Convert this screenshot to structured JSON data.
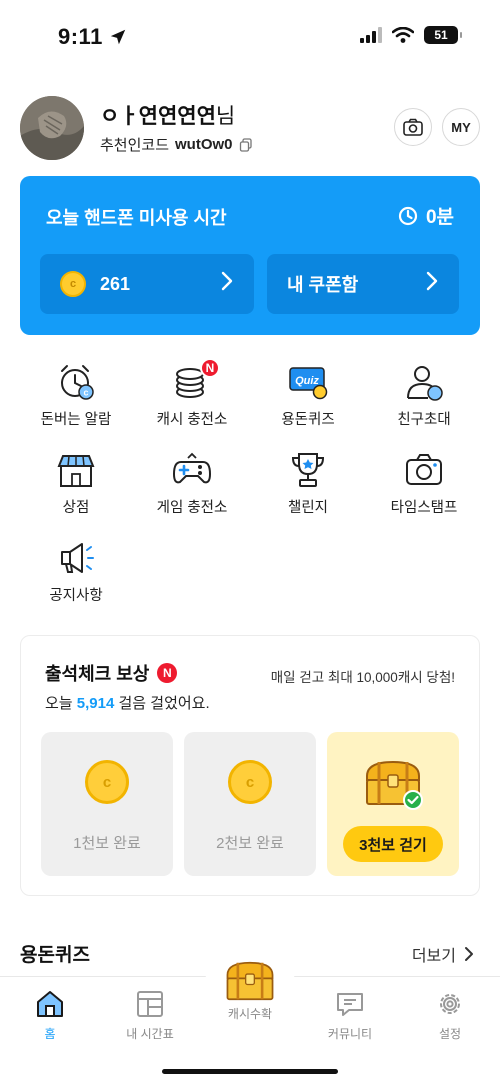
{
  "status_bar": {
    "time": "9:11",
    "battery": "51"
  },
  "profile": {
    "name": "ㅇㅏ연연연연",
    "name_suffix": "님",
    "referral_label": "추천인코드",
    "referral_code": "wutOw0",
    "my_label": "MY"
  },
  "usage_card": {
    "title": "오늘 핸드폰 미사용 시간",
    "time_value": "0분",
    "cash_amount": "261",
    "coupon_label": "내 쿠폰함"
  },
  "menu": [
    {
      "label": "돈버는 알람",
      "icon": "alarm-clock-icon"
    },
    {
      "label": "캐시 충전소",
      "icon": "coin-stack-icon",
      "badge": "N"
    },
    {
      "label": "용돈퀴즈",
      "icon": "quiz-icon",
      "icon_text": "Quiz"
    },
    {
      "label": "친구초대",
      "icon": "invite-friend-icon"
    },
    {
      "label": "상점",
      "icon": "store-icon"
    },
    {
      "label": "게임 충전소",
      "icon": "gamepad-icon"
    },
    {
      "label": "챌린지",
      "icon": "trophy-icon"
    },
    {
      "label": "타임스탬프",
      "icon": "camera-icon"
    },
    {
      "label": "공지사항",
      "icon": "megaphone-icon"
    }
  ],
  "attendance": {
    "title": "출석체크 보상",
    "badge": "N",
    "promo": "매일 걷고 최대 10,000캐시 당첨!",
    "steps_prefix": "오늘",
    "steps_value": "5,914",
    "steps_suffix": "걸음 걸었어요.",
    "rewards": [
      {
        "label": "1천보 완료",
        "state": "done"
      },
      {
        "label": "2천보 완료",
        "state": "done"
      },
      {
        "label": "3천보 걷기",
        "state": "active"
      }
    ]
  },
  "quiz_section": {
    "title": "용돈퀴즈",
    "more_label": "더보기"
  },
  "bottom_nav": [
    {
      "label": "홈",
      "icon": "home-icon",
      "active": true
    },
    {
      "label": "내 시간표",
      "icon": "timetable-icon",
      "active": false
    },
    {
      "label": "캐시수확",
      "icon": "treasure-chest-icon",
      "active": false
    },
    {
      "label": "커뮤니티",
      "icon": "chat-bubble-icon",
      "active": false
    },
    {
      "label": "설정",
      "icon": "gear-icon",
      "active": false
    }
  ],
  "colors": {
    "primary_blue": "#149cf8",
    "dark_blue": "#0b86df",
    "badge_red": "#ee1b2f",
    "coin_yellow": "#ffcc2e",
    "cta_yellow": "#ffc910"
  }
}
